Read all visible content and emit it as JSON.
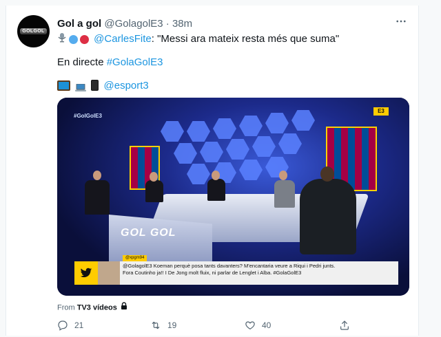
{
  "tweet": {
    "author_name": "Gol a gol",
    "handle": "@GolagolE3",
    "separator": "·",
    "time": "38m",
    "avatar_text": "GOLGOL",
    "line1_mention": "@CarlesFite",
    "line1_text": ": \"Messi ara mateix resta més que suma\"",
    "line2_prefix": "En directe ",
    "line2_hashtag": "#GolaGolE3",
    "line3_mention": "@esport3",
    "from_prefix": "From ",
    "from_source": "TV3 vídeos"
  },
  "media": {
    "corner_tag": "#GolGolE3",
    "channel_badge": "E3",
    "desk_label": "GOL GOL",
    "banner_user": "@xpgm94",
    "banner_line1": "@GolagolE3 Koeman perquè posa tants davanters? M'encantaria veure a Riqui i Pedri junts.",
    "banner_line2": "Fora Coutinho ja!! I De Jong molt fluix, ni parlar de Lenglet i Alba. #GolaGolE3"
  },
  "actions": {
    "reply_count": "21",
    "retweet_count": "19",
    "like_count": "40"
  },
  "icons": {
    "microphone": "studio-microphone-icon",
    "blue_circle": "blue-circle-icon",
    "red_circle": "red-circle-icon",
    "tv": "television-icon",
    "laptop": "laptop-icon",
    "phone": "mobile-phone-icon",
    "lock": "lock-icon",
    "more": "more-icon",
    "reply": "reply-icon",
    "retweet": "retweet-icon",
    "like": "like-icon",
    "share": "share-icon"
  },
  "colors": {
    "link": "#1b95e0",
    "secondary_text": "#536471",
    "primary_text": "#0f1419",
    "blue_circle": "#55acee",
    "red_circle": "#dd2e44"
  }
}
